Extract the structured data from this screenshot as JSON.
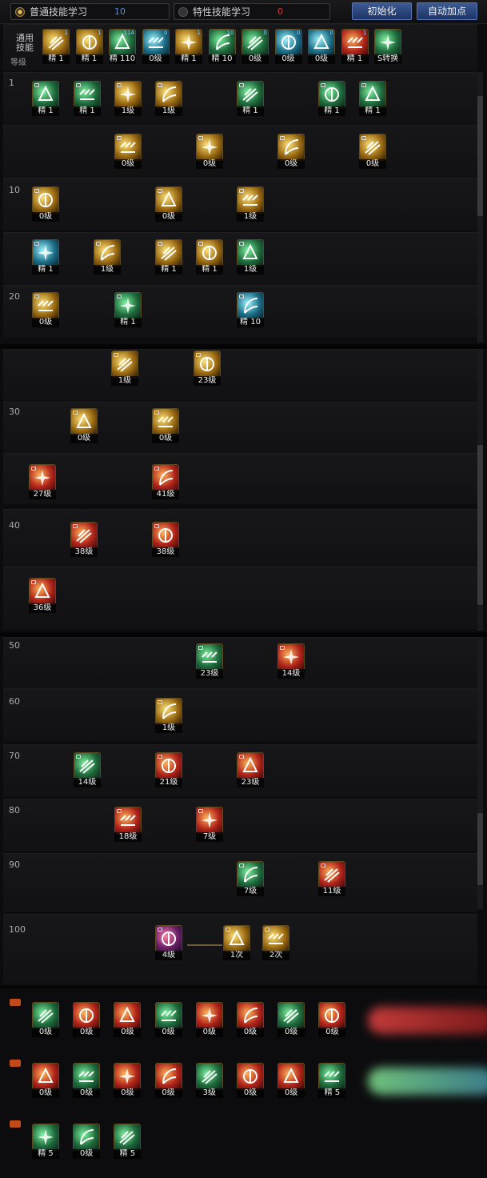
{
  "tabs": {
    "normal": {
      "label": "普通技能学习",
      "value": "10"
    },
    "special": {
      "label": "特性技能学习",
      "value": "0"
    }
  },
  "buttons": {
    "reset": "初始化",
    "auto": "自动加点"
  },
  "general": {
    "label_line1": "通用",
    "label_line2": "技能",
    "level_label": "等级"
  },
  "level_labels": [
    "1",
    "10",
    "20",
    "30",
    "40",
    "50",
    "60",
    "70",
    "80",
    "90",
    "100"
  ],
  "general_skills": [
    {
      "label": "精 1",
      "badge": "1"
    },
    {
      "label": "精 1",
      "badge": "1"
    },
    {
      "label": "精 110",
      "badge": "114"
    },
    {
      "label": "0级",
      "badge": "0"
    },
    {
      "label": "精 1",
      "badge": "1"
    },
    {
      "label": "精 10",
      "badge": "10"
    },
    {
      "label": "0级",
      "badge": "0"
    },
    {
      "label": "0级",
      "badge": "0"
    },
    {
      "label": "0级",
      "badge": "0"
    },
    {
      "label": "精 1",
      "badge": "1"
    },
    {
      "label": "S转换",
      "badge": ""
    }
  ],
  "tree_skills": [
    {
      "label": "精 1"
    },
    {
      "label": "精 1"
    },
    {
      "label": "1级"
    },
    {
      "label": "1级"
    },
    {
      "label": "精 1"
    },
    {
      "label": "精 1"
    },
    {
      "label": "精 1"
    },
    {
      "label": "0级"
    },
    {
      "label": "0级"
    },
    {
      "label": "0级"
    },
    {
      "label": "0级"
    },
    {
      "label": "0级"
    },
    {
      "label": "0级"
    },
    {
      "label": "1级"
    },
    {
      "label": "精 1"
    },
    {
      "label": "1级"
    },
    {
      "label": "精 1"
    },
    {
      "label": "精 1"
    },
    {
      "label": "1级"
    },
    {
      "label": "0级"
    },
    {
      "label": "精 1"
    },
    {
      "label": "精 10"
    },
    {
      "label": "1级"
    },
    {
      "label": "23级"
    },
    {
      "label": "0级"
    },
    {
      "label": "0级"
    },
    {
      "label": "27级"
    },
    {
      "label": "41级"
    },
    {
      "label": "38级"
    },
    {
      "label": "38级"
    },
    {
      "label": "36级"
    },
    {
      "label": "23级"
    },
    {
      "label": "14级"
    },
    {
      "label": "1级"
    },
    {
      "label": "14级"
    },
    {
      "label": "21级"
    },
    {
      "label": "23级"
    },
    {
      "label": "18级"
    },
    {
      "label": "7级"
    },
    {
      "label": "7级"
    },
    {
      "label": "11级"
    },
    {
      "label": "4级"
    },
    {
      "label": "1次"
    },
    {
      "label": "2次"
    }
  ],
  "bottom_skills": [
    {
      "label": "0级"
    },
    {
      "label": "0级"
    },
    {
      "label": "0级"
    },
    {
      "label": "0级"
    },
    {
      "label": "0级"
    },
    {
      "label": "0级"
    },
    {
      "label": "0级"
    },
    {
      "label": "0级"
    },
    {
      "label": "0级"
    },
    {
      "label": "0级"
    },
    {
      "label": "0级"
    },
    {
      "label": "0级"
    },
    {
      "label": "3级"
    },
    {
      "label": "0级"
    },
    {
      "label": "0级"
    },
    {
      "label": "精 5"
    },
    {
      "label": "精 5"
    },
    {
      "label": "0级"
    },
    {
      "label": "精 5"
    }
  ],
  "colors": {
    "accent_blue": "#3c5a92",
    "gold": "#f0c040",
    "red_value": "#d43c3c"
  }
}
